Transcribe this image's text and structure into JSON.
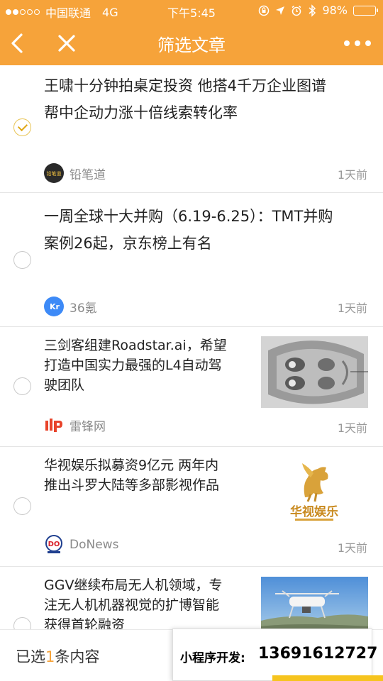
{
  "status": {
    "carrier": "中国联通",
    "network": "4G",
    "time": "下午5:45",
    "battery": "98%",
    "battery_level": 0.98
  },
  "nav": {
    "title": "筛选文章",
    "back_icon": "chevron-left-icon",
    "close_icon": "close-icon",
    "more_icon": "more-dots-icon"
  },
  "articles": [
    {
      "title_line1": "王啸十分钟拍桌定投资 他搭4千万企业图谱",
      "title_line2": "帮中企动力涨十倍线索转化率",
      "source": "铅笔道",
      "source_logo_text": "铅笔道",
      "time": "1天前",
      "selected": true
    },
    {
      "title_line1": "一周全球十大并购（6.19-6.25）：TMT并购",
      "title_line2": "案例26起，京东榜上有名",
      "source": "36氪",
      "source_logo_text": "Kr",
      "time": "1天前",
      "selected": false
    },
    {
      "title_line1": "三剑客组建Roadstar.ai，希望",
      "title_line2": "打造中国实力最强的L4自动驾",
      "title_line3": "驶团队",
      "source": "雷锋网",
      "time": "1天前",
      "selected": false,
      "thumbnail": "car-interior-image"
    },
    {
      "title_line1": "华视娱乐拟募资9亿元 两年内",
      "title_line2": "推出斗罗大陆等多部影视作品",
      "source": "DoNews",
      "source_logo_text": "DO",
      "time": "1天前",
      "selected": false,
      "thumbnail": "huashi-yule-logo-image",
      "thumbnail_text": "华视娱乐"
    },
    {
      "title_line1": "GGV继续布局无人机领域，专",
      "title_line2": "注无人机机器视觉的扩博智能",
      "title_line3": "获得首轮融资",
      "selected": false,
      "thumbnail": "drone-image"
    }
  ],
  "footer": {
    "prefix": "已选",
    "count": "1",
    "suffix": "条内容"
  },
  "watermark": {
    "label": "小程序开发:",
    "phone": "13691612727"
  },
  "colors": {
    "accent": "#f6a33a",
    "check": "#e0a817"
  }
}
